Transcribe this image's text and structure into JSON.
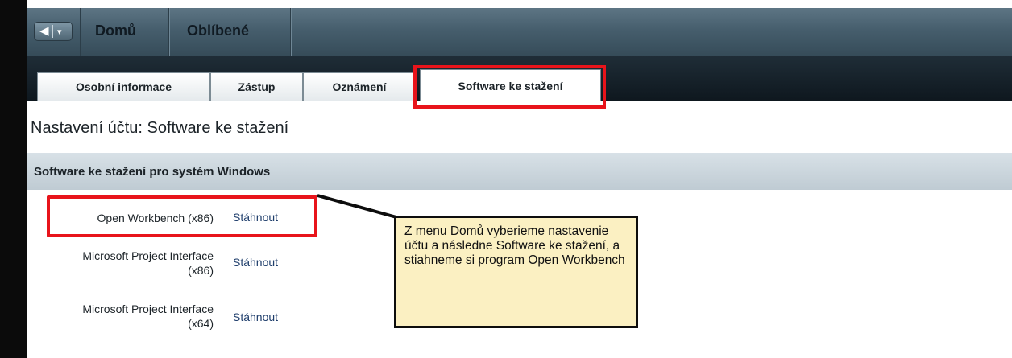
{
  "nav": {
    "back_glyph": "◀",
    "dropdown_glyph": "▾",
    "items": [
      {
        "label": "Domů"
      },
      {
        "label": "Oblíbené"
      }
    ]
  },
  "tabs": [
    {
      "label": "Osobní informace",
      "active": false
    },
    {
      "label": "Zástup",
      "active": false
    },
    {
      "label": "Oznámení",
      "active": false
    },
    {
      "label": "Software ke stažení",
      "active": true
    }
  ],
  "page_title": "Nastavení účtu: Software ke stažení",
  "section": {
    "title": "Software ke stažení pro systém Windows",
    "rows": [
      {
        "name_line1": "Open Workbench (x86)",
        "name_line2": "",
        "link": "Stáhnout"
      },
      {
        "name_line1": "Microsoft Project Interface",
        "name_line2": "(x86)",
        "link": "Stáhnout"
      },
      {
        "name_line1": "Microsoft Project Interface",
        "name_line2": "(x64)",
        "link": "Stáhnout"
      }
    ]
  },
  "callout": {
    "text": "Z menu Domů vyberieme nastavenie účtu a následne Software ke stažení, a stiahneme si program Open Workbench"
  },
  "colors": {
    "highlight": "#e8141b",
    "callout_bg": "#fbf0c2",
    "navbar": "#465e6d",
    "tabstrip": "#14212a",
    "section_header": "#c8d3da"
  }
}
